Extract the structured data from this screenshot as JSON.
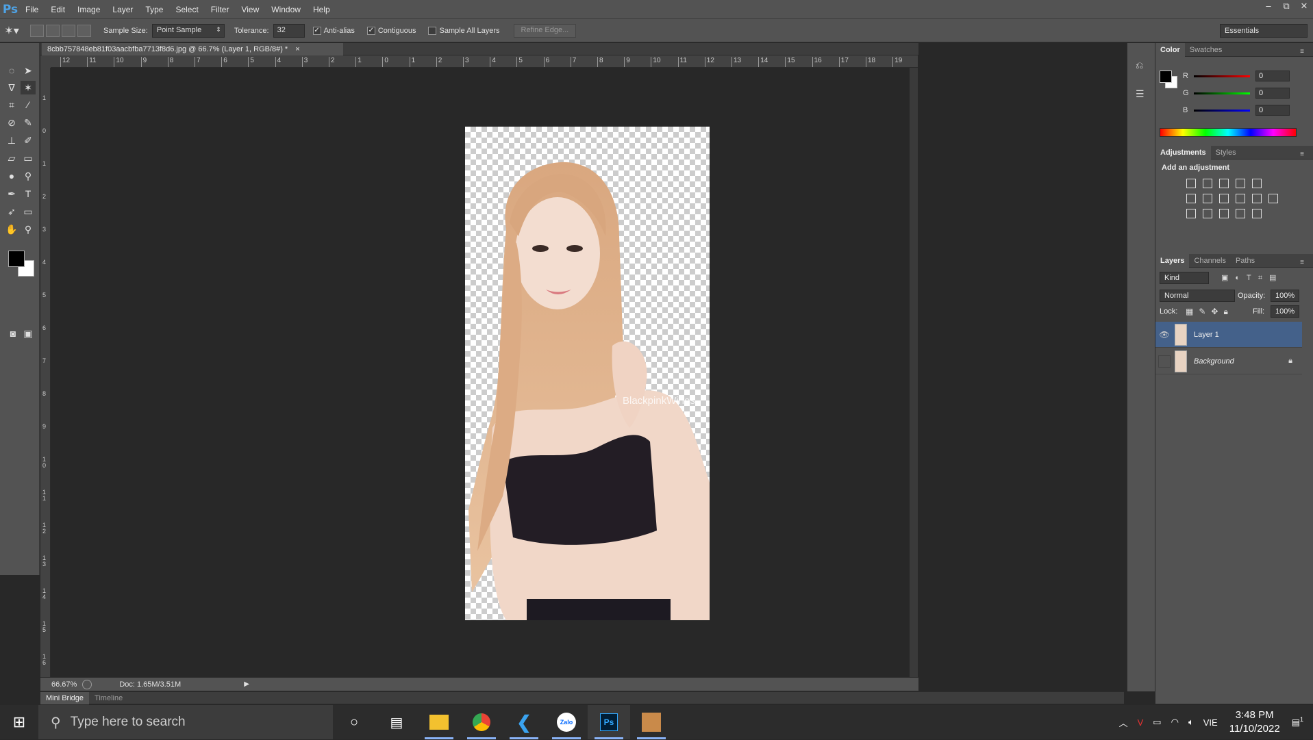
{
  "app": {
    "logo": "Ps"
  },
  "menu": [
    "File",
    "Edit",
    "Image",
    "Layer",
    "Type",
    "Select",
    "Filter",
    "View",
    "Window",
    "Help"
  ],
  "window_controls": [
    "–",
    "⧉",
    "✕"
  ],
  "options": {
    "sample_size_label": "Sample Size:",
    "sample_size_value": "Point Sample",
    "tolerance_label": "Tolerance:",
    "tolerance_value": "32",
    "anti_alias_label": "Anti-alias",
    "contiguous_label": "Contiguous",
    "sample_all_label": "Sample All Layers",
    "refine_edge": "Refine Edge...",
    "workspace": "Essentials"
  },
  "document": {
    "tab_title": "8cbb757848eb81f03aacbfba7713f8d6.jpg @ 66.7% (Layer 1, RGB/8#) *",
    "close": "×",
    "watermark": "BlackpinkWines"
  },
  "ruler_top": [
    "12",
    "11",
    "10",
    "9",
    "8",
    "7",
    "6",
    "5",
    "4",
    "3",
    "2",
    "1",
    "0",
    "1",
    "2",
    "3",
    "4",
    "5",
    "6",
    "7",
    "8",
    "9",
    "10",
    "11",
    "12",
    "13",
    "14",
    "15",
    "16",
    "17",
    "18",
    "19"
  ],
  "ruler_left": [
    "1",
    "0",
    "1",
    "2",
    "3",
    "4",
    "5",
    "6",
    "7",
    "8",
    "9",
    "1 0",
    "1 1",
    "1 2",
    "1 3",
    "1 4",
    "1 5",
    "1 6"
  ],
  "status": {
    "zoom": "66.67%",
    "doc": "Doc: 1.65M/3.51M"
  },
  "bottom_tabs": [
    "Mini Bridge",
    "Timeline"
  ],
  "color_panel": {
    "tabs": [
      "Color",
      "Swatches"
    ],
    "r_label": "R",
    "r_value": "0",
    "g_label": "G",
    "g_value": "0",
    "b_label": "B",
    "b_value": "0"
  },
  "adjustments": {
    "tabs": [
      "Adjustments",
      "Styles"
    ],
    "title": "Add an adjustment"
  },
  "layers_panel": {
    "tabs": [
      "Layers",
      "Channels",
      "Paths"
    ],
    "kind": "Kind",
    "blend": "Normal",
    "opacity_label": "Opacity:",
    "opacity_value": "100%",
    "lock_label": "Lock:",
    "fill_label": "Fill:",
    "fill_value": "100%",
    "layers": [
      {
        "name": "Layer 1",
        "visible": true,
        "selected": true
      },
      {
        "name": "Background",
        "visible": false,
        "selected": false,
        "locked": true
      }
    ]
  },
  "taskbar": {
    "search_placeholder": "Type here to search",
    "lang": "VIE",
    "time": "3:48 PM",
    "date": "11/10/2022",
    "notif_count": "1"
  },
  "colors": {
    "accent": "#4ea3e6",
    "panel": "#535353",
    "canvas_bg": "#282828",
    "layer_selected": "#44618a"
  }
}
